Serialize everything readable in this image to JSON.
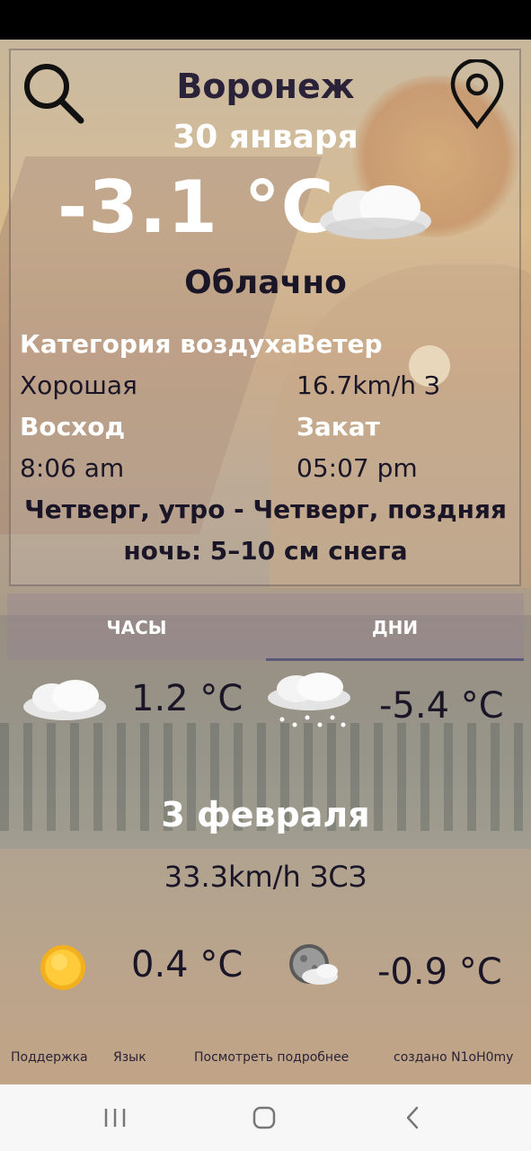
{
  "header": {
    "city": "Воронеж",
    "date": "30 января"
  },
  "current": {
    "temperature": "-3.1 °C",
    "condition": "Облачно",
    "icon": "cloud-icon"
  },
  "details": {
    "air_quality_label": "Категория воздуха",
    "air_quality_value": "Хорошая",
    "wind_label": "Ветер",
    "wind_value": "16.7km/h З",
    "sunrise_label": "Восход",
    "sunrise_value": "8:06 am",
    "sunset_label": "Закат",
    "sunset_value": "05:07 pm",
    "forecast_note": "Четверг, утро - Четверг, поздняя ночь: 5–10 см снега"
  },
  "tabs": [
    {
      "label": "ЧАСЫ",
      "active": false
    },
    {
      "label": "ДНИ",
      "active": true
    }
  ],
  "forecast": {
    "row1": [
      {
        "icon": "cloud-icon",
        "temperature": "1.2 °C"
      },
      {
        "icon": "snow-cloud-icon",
        "temperature": "-5.4 °C"
      }
    ],
    "date": "3 февраля",
    "wind": "33.3km/h ЗСЗ",
    "row2": [
      {
        "icon": "sun-icon",
        "temperature": "0.4 °C"
      },
      {
        "icon": "moon-cloud-icon",
        "temperature": "-0.9 °C"
      }
    ]
  },
  "footer": {
    "support": "Поддержка",
    "language": "Язык",
    "more": "Посмотреть подробнее",
    "credit": "создано N1oH0my"
  },
  "colors": {
    "accent_dark": "#1a1628",
    "text_white": "#ffffff",
    "tab_indicator": "#5a5a78"
  }
}
